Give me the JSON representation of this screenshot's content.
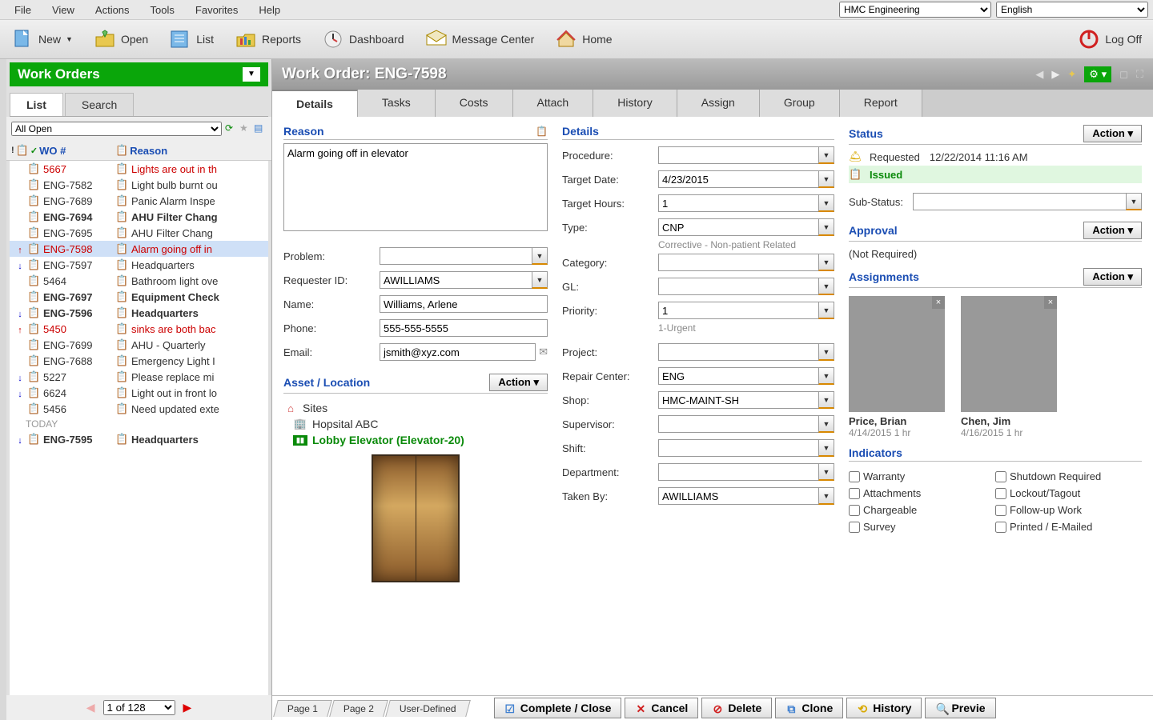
{
  "menu": [
    "File",
    "View",
    "Actions",
    "Tools",
    "Favorites",
    "Help"
  ],
  "top_selects": {
    "dept": "HMC Engineering",
    "lang": "English"
  },
  "toolbar": {
    "new": "New",
    "open": "Open",
    "list": "List",
    "reports": "Reports",
    "dashboard": "Dashboard",
    "msgcenter": "Message Center",
    "home": "Home",
    "logoff": "Log Off"
  },
  "left": {
    "title": "Work Orders",
    "tabs": [
      "List",
      "Search"
    ],
    "filter": "All Open",
    "cols": {
      "wo": "WO #",
      "reason": "Reason"
    },
    "rows": [
      {
        "arrow": "",
        "wo": "5667",
        "reason": "Lights are out in th",
        "red": true
      },
      {
        "arrow": "",
        "wo": "ENG-7582",
        "reason": "Light bulb burnt ou"
      },
      {
        "arrow": "",
        "wo": "ENG-7689",
        "reason": "Panic Alarm Inspe"
      },
      {
        "arrow": "",
        "wo": "ENG-7694",
        "reason": "AHU Filter Chang",
        "bold": true
      },
      {
        "arrow": "",
        "wo": "ENG-7695",
        "reason": "AHU Filter Chang"
      },
      {
        "arrow": "up",
        "wo": "ENG-7598",
        "reason": "Alarm going off in",
        "red": true,
        "sel": true
      },
      {
        "arrow": "down",
        "wo": "ENG-7597",
        "reason": "Headquarters"
      },
      {
        "arrow": "",
        "wo": "5464",
        "reason": "Bathroom light ove"
      },
      {
        "arrow": "",
        "wo": "ENG-7697",
        "reason": "Equipment Check",
        "bold": true
      },
      {
        "arrow": "down",
        "wo": "ENG-7596",
        "reason": "Headquarters",
        "bold": true
      },
      {
        "arrow": "up",
        "wo": "5450",
        "reason": "sinks are both bac",
        "red": true
      },
      {
        "arrow": "",
        "wo": "ENG-7699",
        "reason": "AHU - Quarterly"
      },
      {
        "arrow": "",
        "wo": "ENG-7688",
        "reason": "Emergency Light I"
      },
      {
        "arrow": "down",
        "wo": "5227",
        "reason": "Please replace mi"
      },
      {
        "arrow": "down",
        "wo": "6624",
        "reason": "Light out in front lo"
      },
      {
        "arrow": "",
        "wo": "5456",
        "reason": "Need updated exte"
      }
    ],
    "today": "TODAY",
    "rows2": [
      {
        "arrow": "down",
        "wo": "ENG-7595",
        "reason": "Headquarters",
        "bold": true
      }
    ],
    "pager": "1 of 128"
  },
  "right": {
    "title": "Work Order: ENG-7598",
    "tabs": [
      "Details",
      "Tasks",
      "Costs",
      "Attach",
      "History",
      "Assign",
      "Group",
      "Report"
    ],
    "reason_title": "Reason",
    "reason": "Alarm going off in elevator",
    "labels": {
      "problem": "Problem:",
      "reqid": "Requester ID:",
      "name": "Name:",
      "phone": "Phone:",
      "email": "Email:",
      "asset": "Asset / Location",
      "action": "Action",
      "details": "Details",
      "procedure": "Procedure:",
      "targetdate": "Target Date:",
      "targethours": "Target Hours:",
      "type": "Type:",
      "category": "Category:",
      "gl": "GL:",
      "priority": "Priority:",
      "project": "Project:",
      "repaircenter": "Repair Center:",
      "shop": "Shop:",
      "supervisor": "Supervisor:",
      "shift": "Shift:",
      "dept": "Department:",
      "takenby": "Taken By:",
      "status": "Status",
      "requested": "Requested",
      "issued": "Issued",
      "substatus": "Sub-Status:",
      "approval": "Approval",
      "notreq": "(Not Required)",
      "assignments": "Assignments",
      "indicators": "Indicators"
    },
    "values": {
      "problem": "",
      "reqid": "AWILLIAMS",
      "name": "Williams, Arlene",
      "phone": "555-555-5555",
      "email": "jsmith@xyz.com",
      "procedure": "",
      "targetdate": "4/23/2015",
      "targethours": "1",
      "type": "CNP",
      "typedesc": "Corrective - Non-patient Related",
      "category": "",
      "gl": "",
      "priority": "1",
      "prioritydesc": "1-Urgent",
      "project": "",
      "repaircenter": "ENG",
      "shop": "HMC-MAINT-SH",
      "supervisor": "",
      "shift": "",
      "dept": "",
      "takenby": "AWILLIAMS",
      "req_date": "12/22/2014 11:16 AM",
      "substatus": ""
    },
    "tree": {
      "sites": "Sites",
      "hospital": "Hopsital ABC",
      "elevator": "Lobby Elevator (Elevator-20)"
    },
    "assign": [
      {
        "name": "Price, Brian",
        "date": "4/14/2015 1 hr",
        "photo": "photo1"
      },
      {
        "name": "Chen, Jim",
        "date": "4/16/2015 1 hr",
        "photo": "photo2"
      }
    ],
    "indicators": [
      "Warranty",
      "Shutdown Required",
      "Attachments",
      "Lockout/Tagout",
      "Chargeable",
      "Follow-up Work",
      "Survey",
      "Printed / E-Mailed"
    ],
    "page_tabs": [
      "Page 1",
      "Page 2",
      "User-Defined"
    ],
    "buttons": {
      "complete": "Complete / Close",
      "cancel": "Cancel",
      "delete": "Delete",
      "clone": "Clone",
      "history": "History",
      "preview": "Previe"
    }
  }
}
